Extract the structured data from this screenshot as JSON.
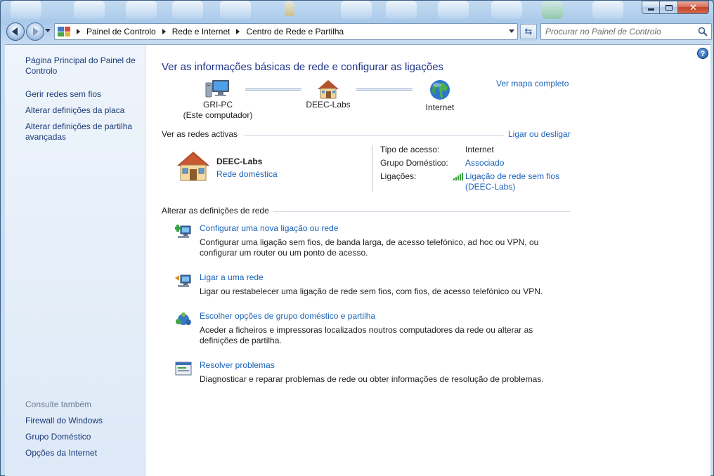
{
  "window": {
    "minimize_icon": "minimize-icon",
    "maximize_icon": "maximize-icon",
    "close_icon": "close-icon"
  },
  "navbar": {
    "breadcrumbs": [
      "Painel de Controlo",
      "Rede e Internet",
      "Centro de Rede e Partilha"
    ],
    "search_placeholder": "Procurar no Painel de Controlo"
  },
  "sidebar": {
    "links": [
      "Página Principal do Painel de Controlo",
      "Gerir redes sem fios",
      "Alterar definições da placa",
      "Alterar definições de partilha avançadas"
    ],
    "see_also_title": "Consulte também",
    "see_also_links": [
      "Firewall do Windows",
      "Grupo Doméstico",
      "Opções da Internet"
    ]
  },
  "main": {
    "title": "Ver as informações básicas de rede e configurar as ligações",
    "map": {
      "computer_name": "GRI-PC",
      "computer_caption": "(Este computador)",
      "network_name": "DEEC-Labs",
      "internet_label": "Internet",
      "view_full_map": "Ver mapa completo"
    },
    "active_networks": {
      "header": "Ver as redes activas",
      "connect_link": "Ligar ou desligar",
      "network_name": "DEEC-Labs",
      "network_type": "Rede doméstica",
      "properties": [
        {
          "label": "Tipo de acesso:",
          "value": "Internet"
        },
        {
          "label": "Grupo Doméstico:",
          "value": "Associado"
        },
        {
          "label": "Ligações:",
          "value": "Ligação de rede sem fios (DEEC-Labs)"
        }
      ]
    },
    "change_settings": {
      "header": "Alterar as definições de rede",
      "tasks": [
        {
          "title": "Configurar uma nova ligação ou rede",
          "description": "Configurar uma ligação sem fios, de banda larga, de acesso telefónico, ad hoc ou VPN, ou configurar um router ou um ponto de acesso.",
          "icon": "new-connection-icon"
        },
        {
          "title": "Ligar a uma rede",
          "description": "Ligar ou restabelecer uma ligação de rede sem fios, com fios, de acesso telefónico ou VPN.",
          "icon": "connect-network-icon"
        },
        {
          "title": "Escolher opções de grupo doméstico e partilha",
          "description": "Aceder a ficheiros e impressoras localizados noutros computadores da rede ou alterar as definições de partilha.",
          "icon": "homegroup-icon"
        },
        {
          "title": "Resolver problemas",
          "description": "Diagnosticar e reparar problemas de rede ou obter informações de resolução de problemas.",
          "icon": "troubleshoot-icon"
        }
      ]
    }
  },
  "colors": {
    "link": "#1a62b8",
    "title": "#1e3287",
    "sidebar_link": "#1a3a78",
    "sidebar_bg": "#dde9f7"
  }
}
